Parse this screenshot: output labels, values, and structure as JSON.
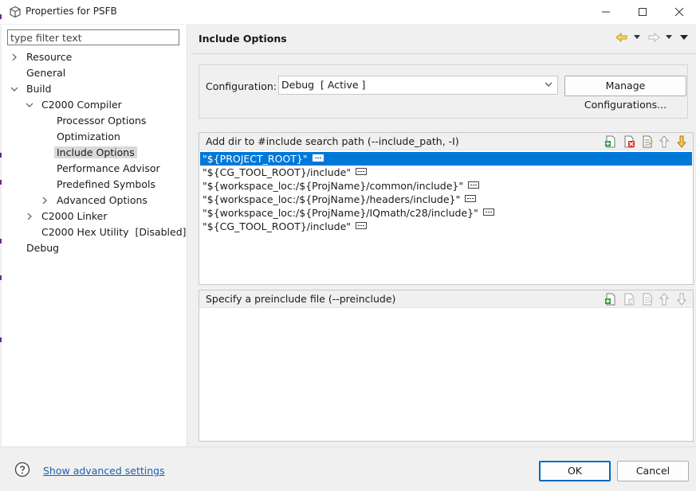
{
  "window": {
    "title": "Properties for PSFB"
  },
  "filter": {
    "placeholder": "type filter text"
  },
  "tree": {
    "resource": "Resource",
    "general": "General",
    "build": "Build",
    "c2000_compiler": "C2000 Compiler",
    "processor_options": "Processor Options",
    "optimization": "Optimization",
    "include_options": "Include Options",
    "performance_advisor": "Performance Advisor",
    "predefined_symbols": "Predefined Symbols",
    "advanced_options": "Advanced Options",
    "c2000_linker": "C2000 Linker",
    "c2000_hex_utility": "C2000 Hex Utility  [Disabled]",
    "debug": "Debug"
  },
  "page": {
    "title": "Include Options"
  },
  "config": {
    "label": "Configuration:",
    "value": "Debug  [ Active ]",
    "manage_label": "Manage Configurations..."
  },
  "include_panel": {
    "title": "Add dir to #include search path (--include_path, -I)",
    "items": [
      "\"${PROJECT_ROOT}\"",
      "\"${CG_TOOL_ROOT}/include\"",
      "\"${workspace_loc:/${ProjName}/common/include}\"",
      "\"${workspace_loc:/${ProjName}/headers/include}\"",
      "\"${workspace_loc:/${ProjName}/IQmath/c28/include}\"",
      "\"${CG_TOOL_ROOT}/include\""
    ]
  },
  "preinclude_panel": {
    "title": "Specify a preinclude file (--preinclude)"
  },
  "footer": {
    "advanced_link": "Show advanced settings",
    "ok_label": "OK",
    "cancel_label": "Cancel"
  },
  "colors": {
    "selection": "#0078d7",
    "link": "#1a5fb4",
    "tree_selection": "#d9d9d9"
  },
  "icons": {
    "app": "gear-cube-icon",
    "minimize": "minimize-icon",
    "maximize": "maximize-icon",
    "close": "close-icon",
    "back": "back-arrow-icon",
    "forward": "forward-arrow-icon",
    "view_menu": "view-menu-icon",
    "add": "add-icon",
    "delete": "delete-icon",
    "edit": "edit-icon",
    "move_up": "move-up-icon",
    "move_down": "move-down-icon",
    "help": "help-icon"
  }
}
